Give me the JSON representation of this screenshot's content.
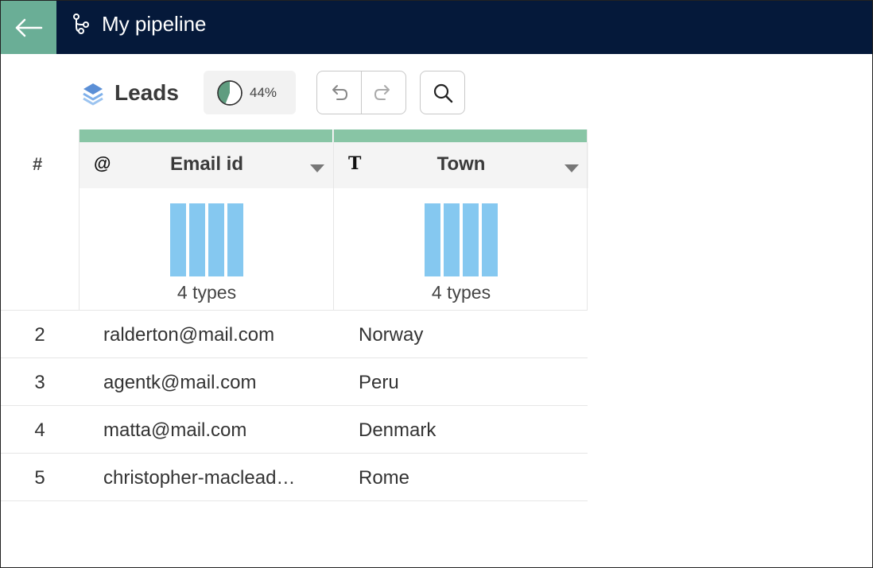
{
  "header": {
    "title": "My pipeline",
    "back_icon": "arrow-left-icon",
    "pipeline_icon": "pipeline-branch-icon",
    "bg_color": "#05193a",
    "back_color": "#6aae96"
  },
  "toolbar": {
    "dataset_name": "Leads",
    "dataset_icon": "layers-icon",
    "quality_percent": "44%",
    "quality_fraction": 0.44,
    "undo_icon": "undo-icon",
    "redo_icon": "redo-icon",
    "search_icon": "search-icon"
  },
  "grid": {
    "row_number_header": "#",
    "columns": [
      {
        "name": "Email id",
        "type_symbol": "@",
        "profile_label": "4 types"
      },
      {
        "name": "Town",
        "type_symbol": "T",
        "profile_label": "4 types"
      }
    ],
    "rows": [
      {
        "num": "2",
        "email": "ralderton@mail.com",
        "town": "Norway"
      },
      {
        "num": "3",
        "email": "agentk@mail.com",
        "town": "Peru"
      },
      {
        "num": "4",
        "email": "matta@mail.com",
        "town": "Denmark"
      },
      {
        "num": "5",
        "email": "christopher-maclead…",
        "town": "Rome"
      }
    ],
    "quality_bar_color": "#88c5a5",
    "type_bar_color": "#85c8f0"
  }
}
